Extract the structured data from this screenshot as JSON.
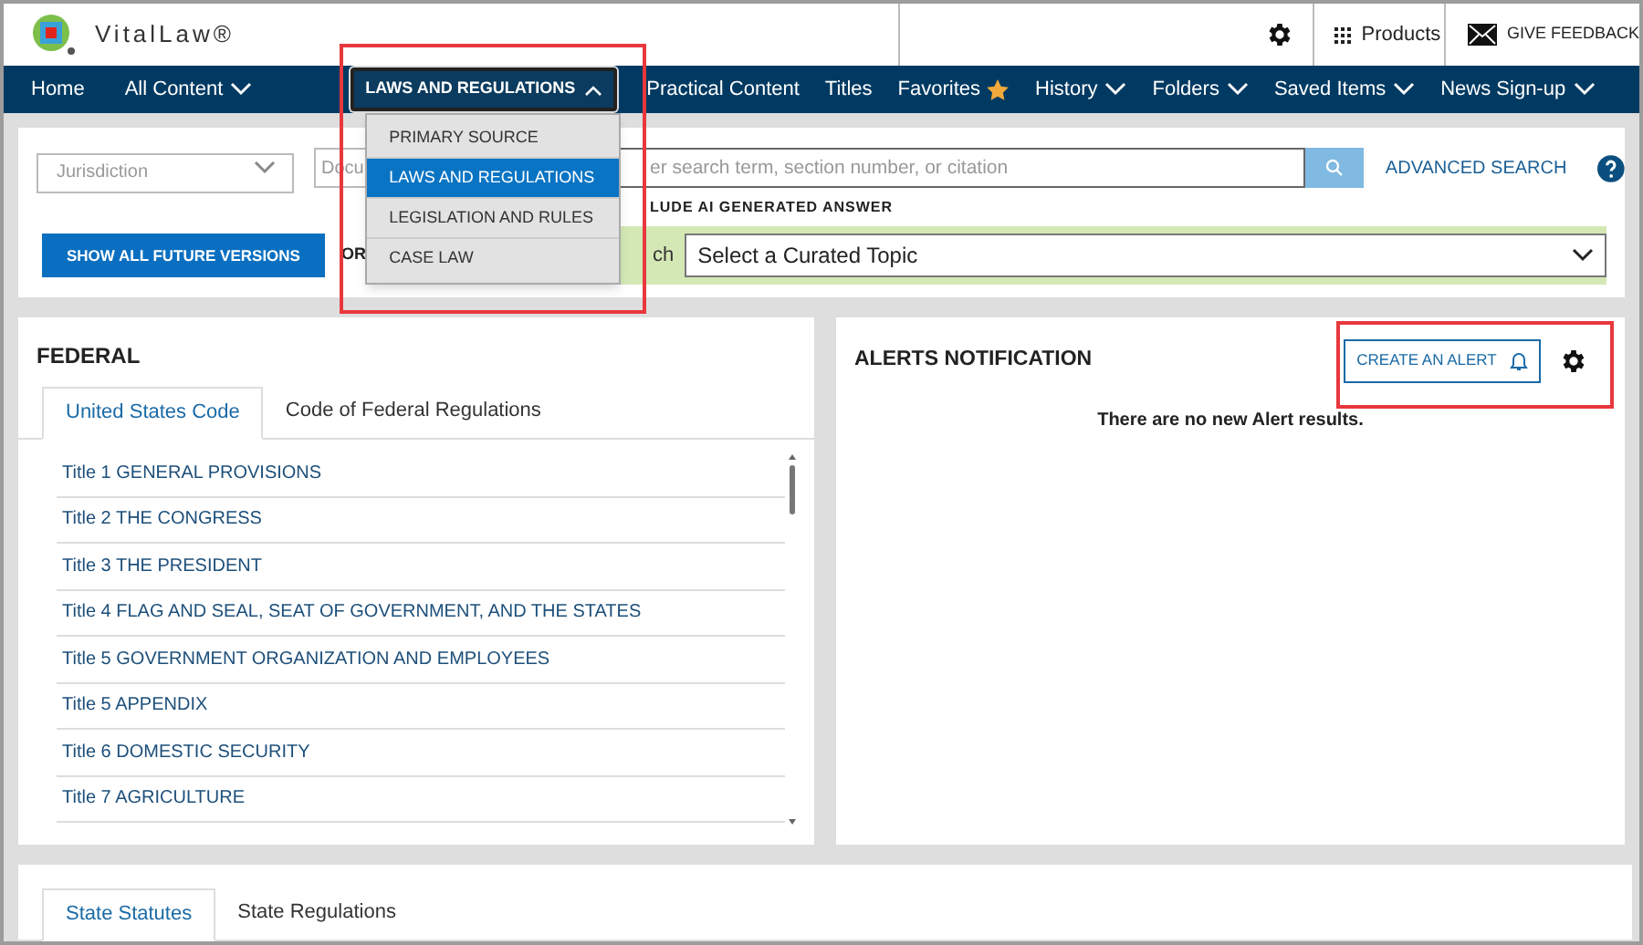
{
  "header": {
    "logo_text": "VitalLaw®",
    "products": "Products",
    "feedback": "GIVE FEEDBACK"
  },
  "nav": [
    {
      "kind": "link",
      "label": "Home"
    },
    {
      "kind": "menu",
      "label": "All Content"
    },
    {
      "kind": "open_menu",
      "label": "LAWS AND REGULATIONS",
      "menu_items": [
        {
          "label": "PRIMARY SOURCE",
          "selected": false
        },
        {
          "label": "LAWS AND REGULATIONS",
          "selected": true
        },
        {
          "label": "LEGISLATION AND RULES",
          "selected": false
        },
        {
          "label": "CASE LAW",
          "selected": false
        }
      ]
    },
    {
      "kind": "link",
      "label": "Practical Content"
    },
    {
      "kind": "link",
      "label": "Titles"
    },
    {
      "kind": "favorites",
      "label": "Favorites"
    },
    {
      "kind": "menu",
      "label": "History"
    },
    {
      "kind": "menu",
      "label": "Folders"
    },
    {
      "kind": "menu",
      "label": "Saved Items"
    },
    {
      "kind": "menu",
      "label": "News Sign-up"
    }
  ],
  "search": {
    "jurisdiction": {
      "placeholder": "Jurisdiction"
    },
    "document": {
      "placeholder": "Docu"
    },
    "query": {
      "placeholder": "er search term, section number, or citation"
    },
    "ai_option": "LUDE AI GENERATED ANSWER",
    "advanced": "ADVANCED SEARCH"
  },
  "versions_button": "SHOW ALL FUTURE VERSIONS",
  "or_label": "OR",
  "topic_label": "ch",
  "topic_select": "Select a Curated Topic",
  "federal": {
    "title": "FEDERAL",
    "tabs": [
      {
        "label": "United States Code",
        "selected": true
      },
      {
        "label": "Code of Federal Regulations",
        "selected": false
      }
    ],
    "titles": [
      "Title 1 GENERAL PROVISIONS",
      "Title 2 THE CONGRESS",
      "Title 3 THE PRESIDENT",
      "Title 4 FLAG AND SEAL, SEAT OF GOVERNMENT, AND THE STATES",
      "Title 5 GOVERNMENT ORGANIZATION AND EMPLOYEES",
      "Title 5 APPENDIX",
      "Title 6 DOMESTIC SECURITY",
      "Title 7 AGRICULTURE"
    ]
  },
  "alerts": {
    "title": "ALERTS NOTIFICATION",
    "create_button": "CREATE AN ALERT",
    "message": "There are no new Alert results."
  },
  "state": {
    "tabs": [
      {
        "label": "State Statutes",
        "selected": true
      },
      {
        "label": "State Regulations",
        "selected": false
      }
    ]
  }
}
